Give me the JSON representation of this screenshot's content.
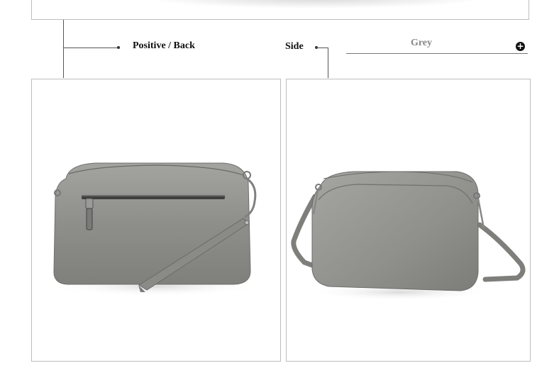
{
  "labels": {
    "positive_back": "Positive / Back",
    "side": "Side"
  },
  "color_option": {
    "name": "Grey",
    "expand_icon": "plus-circle-icon"
  },
  "colors": {
    "bag": "#8f8f8c",
    "frame": "#bdbdbd",
    "line": "#555555"
  }
}
